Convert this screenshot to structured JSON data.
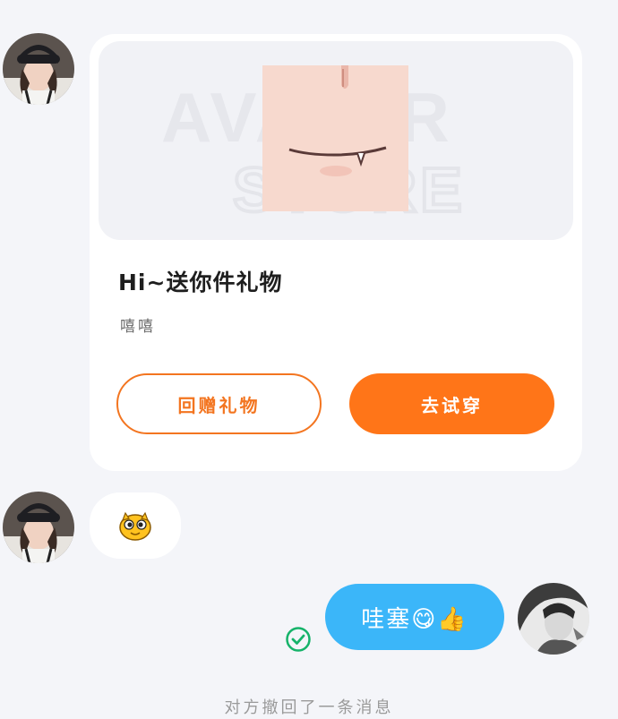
{
  "chat": {
    "gift_card": {
      "title": "Hi~送你件礼物",
      "subtitle": "嘻嘻",
      "watermark_text": "AVATAR STORE",
      "return_gift_label": "回赠礼物",
      "try_on_label": "去试穿"
    },
    "incoming_emoji": "sticker-face",
    "outgoing_message": "哇塞😋👍",
    "recall_notice": "对方撤回了一条消息"
  },
  "colors": {
    "accent_orange": "#ff7518",
    "outgoing_bubble": "#3bb6f9",
    "sent_check": "#16b36a",
    "background": "#f4f5f9"
  },
  "icons": [
    "contact-avatar",
    "self-avatar",
    "sticker-face-icon",
    "sent-check-icon"
  ]
}
